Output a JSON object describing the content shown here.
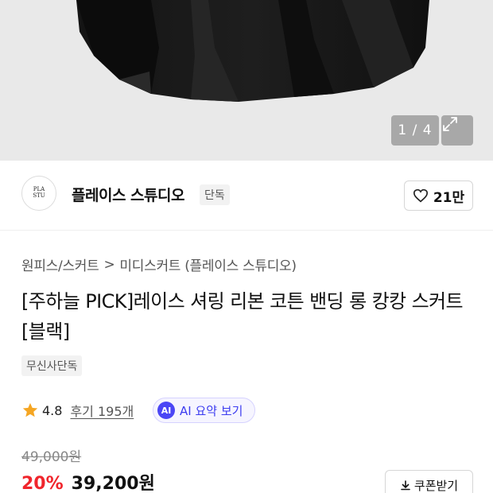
{
  "gallery": {
    "counter": "1 / 4"
  },
  "brand": {
    "logo_text": "PLACES STUDIO",
    "name": "플레이스 스튜디오",
    "tag": "단독",
    "like_count": "21만"
  },
  "category": {
    "primary": "원피스/스커트",
    "separator": ">",
    "secondary": "미디스커트 (플레이스 스튜디오)"
  },
  "product": {
    "title": "[주하늘 PICK]레이스 셔링 리본 코튼 밴딩 롱 캉캉 스커트 [블랙]",
    "badge": "무신사단독"
  },
  "rating": {
    "score": "4.8",
    "review_label": "후기 195개",
    "ai_icon": "AI",
    "ai_label": "AI 요약 보기"
  },
  "price": {
    "original": "49,000원",
    "discount": "20%",
    "sale": "39,200원",
    "coupon_label": "쿠폰받기"
  },
  "colors": {
    "discount_red": "#f0252c",
    "ai_purple": "#4b46f5",
    "star_orange": "#f5a623"
  }
}
